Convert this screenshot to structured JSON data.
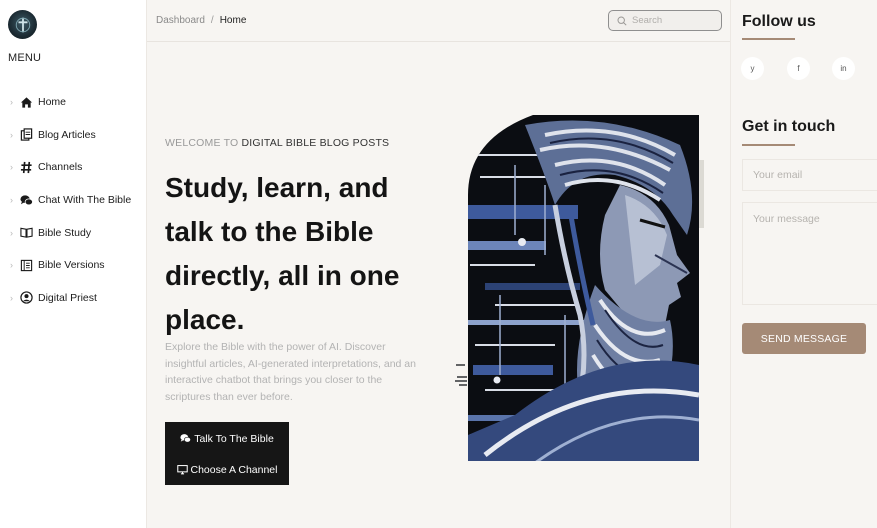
{
  "sidebar": {
    "menu_title": "MENU",
    "items": [
      {
        "label": "Home",
        "icon": "home-icon"
      },
      {
        "label": "Blog Articles",
        "icon": "articles-icon"
      },
      {
        "label": "Channels",
        "icon": "hashtag-icon"
      },
      {
        "label": "Chat With The Bible",
        "icon": "chat-icon"
      },
      {
        "label": "Bible Study",
        "icon": "book-icon"
      },
      {
        "label": "Bible Versions",
        "icon": "versions-icon"
      },
      {
        "label": "Digital Priest",
        "icon": "user-icon"
      }
    ]
  },
  "breadcrumb": {
    "parent": "Dashboard",
    "separator": "/",
    "current": "Home"
  },
  "search": {
    "placeholder": "Search"
  },
  "hero": {
    "welcome_prefix": "WELCOME TO",
    "welcome_highlight": "DIGITAL BIBLE BLOG POSTS",
    "headline": "Study, learn, and talk to the Bible directly, all in one place.",
    "description": "Explore the Bible with the power of AI. Discover insightful articles, AI-generated interpretations, and an interactive chatbot that brings you closer to the scriptures than ever before.",
    "cta_primary": "Talk To The Bible",
    "cta_secondary": "Choose A Channel"
  },
  "right": {
    "follow_title": "Follow us",
    "socials": [
      {
        "label": "y",
        "icon": "twitter-icon"
      },
      {
        "label": "f",
        "icon": "facebook-icon"
      },
      {
        "label": "in",
        "icon": "linkedin-icon"
      }
    ],
    "touch_title": "Get in touch",
    "email_placeholder": "Your email",
    "message_placeholder": "Your message",
    "send_label": "SEND MESSAGE"
  },
  "colors": {
    "accent": "#a58a76",
    "background": "#f7f5f2",
    "cta_background": "#161616",
    "art_blue": "#3e5a9c"
  }
}
